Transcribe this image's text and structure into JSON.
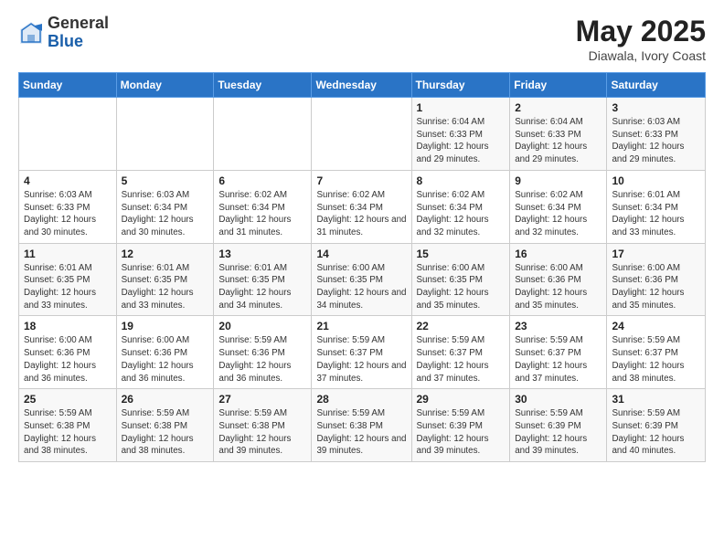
{
  "header": {
    "logo_general": "General",
    "logo_blue": "Blue",
    "month_year": "May 2025",
    "location": "Diawala, Ivory Coast"
  },
  "days_of_week": [
    "Sunday",
    "Monday",
    "Tuesday",
    "Wednesday",
    "Thursday",
    "Friday",
    "Saturday"
  ],
  "weeks": [
    [
      {
        "day": "",
        "info": ""
      },
      {
        "day": "",
        "info": ""
      },
      {
        "day": "",
        "info": ""
      },
      {
        "day": "",
        "info": ""
      },
      {
        "day": "1",
        "info": "Sunrise: 6:04 AM\nSunset: 6:33 PM\nDaylight: 12 hours\nand 29 minutes."
      },
      {
        "day": "2",
        "info": "Sunrise: 6:04 AM\nSunset: 6:33 PM\nDaylight: 12 hours\nand 29 minutes."
      },
      {
        "day": "3",
        "info": "Sunrise: 6:03 AM\nSunset: 6:33 PM\nDaylight: 12 hours\nand 29 minutes."
      }
    ],
    [
      {
        "day": "4",
        "info": "Sunrise: 6:03 AM\nSunset: 6:33 PM\nDaylight: 12 hours\nand 30 minutes."
      },
      {
        "day": "5",
        "info": "Sunrise: 6:03 AM\nSunset: 6:34 PM\nDaylight: 12 hours\nand 30 minutes."
      },
      {
        "day": "6",
        "info": "Sunrise: 6:02 AM\nSunset: 6:34 PM\nDaylight: 12 hours\nand 31 minutes."
      },
      {
        "day": "7",
        "info": "Sunrise: 6:02 AM\nSunset: 6:34 PM\nDaylight: 12 hours\nand 31 minutes."
      },
      {
        "day": "8",
        "info": "Sunrise: 6:02 AM\nSunset: 6:34 PM\nDaylight: 12 hours\nand 32 minutes."
      },
      {
        "day": "9",
        "info": "Sunrise: 6:02 AM\nSunset: 6:34 PM\nDaylight: 12 hours\nand 32 minutes."
      },
      {
        "day": "10",
        "info": "Sunrise: 6:01 AM\nSunset: 6:34 PM\nDaylight: 12 hours\nand 33 minutes."
      }
    ],
    [
      {
        "day": "11",
        "info": "Sunrise: 6:01 AM\nSunset: 6:35 PM\nDaylight: 12 hours\nand 33 minutes."
      },
      {
        "day": "12",
        "info": "Sunrise: 6:01 AM\nSunset: 6:35 PM\nDaylight: 12 hours\nand 33 minutes."
      },
      {
        "day": "13",
        "info": "Sunrise: 6:01 AM\nSunset: 6:35 PM\nDaylight: 12 hours\nand 34 minutes."
      },
      {
        "day": "14",
        "info": "Sunrise: 6:00 AM\nSunset: 6:35 PM\nDaylight: 12 hours\nand 34 minutes."
      },
      {
        "day": "15",
        "info": "Sunrise: 6:00 AM\nSunset: 6:35 PM\nDaylight: 12 hours\nand 35 minutes."
      },
      {
        "day": "16",
        "info": "Sunrise: 6:00 AM\nSunset: 6:36 PM\nDaylight: 12 hours\nand 35 minutes."
      },
      {
        "day": "17",
        "info": "Sunrise: 6:00 AM\nSunset: 6:36 PM\nDaylight: 12 hours\nand 35 minutes."
      }
    ],
    [
      {
        "day": "18",
        "info": "Sunrise: 6:00 AM\nSunset: 6:36 PM\nDaylight: 12 hours\nand 36 minutes."
      },
      {
        "day": "19",
        "info": "Sunrise: 6:00 AM\nSunset: 6:36 PM\nDaylight: 12 hours\nand 36 minutes."
      },
      {
        "day": "20",
        "info": "Sunrise: 5:59 AM\nSunset: 6:36 PM\nDaylight: 12 hours\nand 36 minutes."
      },
      {
        "day": "21",
        "info": "Sunrise: 5:59 AM\nSunset: 6:37 PM\nDaylight: 12 hours\nand 37 minutes."
      },
      {
        "day": "22",
        "info": "Sunrise: 5:59 AM\nSunset: 6:37 PM\nDaylight: 12 hours\nand 37 minutes."
      },
      {
        "day": "23",
        "info": "Sunrise: 5:59 AM\nSunset: 6:37 PM\nDaylight: 12 hours\nand 37 minutes."
      },
      {
        "day": "24",
        "info": "Sunrise: 5:59 AM\nSunset: 6:37 PM\nDaylight: 12 hours\nand 38 minutes."
      }
    ],
    [
      {
        "day": "25",
        "info": "Sunrise: 5:59 AM\nSunset: 6:38 PM\nDaylight: 12 hours\nand 38 minutes."
      },
      {
        "day": "26",
        "info": "Sunrise: 5:59 AM\nSunset: 6:38 PM\nDaylight: 12 hours\nand 38 minutes."
      },
      {
        "day": "27",
        "info": "Sunrise: 5:59 AM\nSunset: 6:38 PM\nDaylight: 12 hours\nand 39 minutes."
      },
      {
        "day": "28",
        "info": "Sunrise: 5:59 AM\nSunset: 6:38 PM\nDaylight: 12 hours\nand 39 minutes."
      },
      {
        "day": "29",
        "info": "Sunrise: 5:59 AM\nSunset: 6:39 PM\nDaylight: 12 hours\nand 39 minutes."
      },
      {
        "day": "30",
        "info": "Sunrise: 5:59 AM\nSunset: 6:39 PM\nDaylight: 12 hours\nand 39 minutes."
      },
      {
        "day": "31",
        "info": "Sunrise: 5:59 AM\nSunset: 6:39 PM\nDaylight: 12 hours\nand 40 minutes."
      }
    ]
  ]
}
